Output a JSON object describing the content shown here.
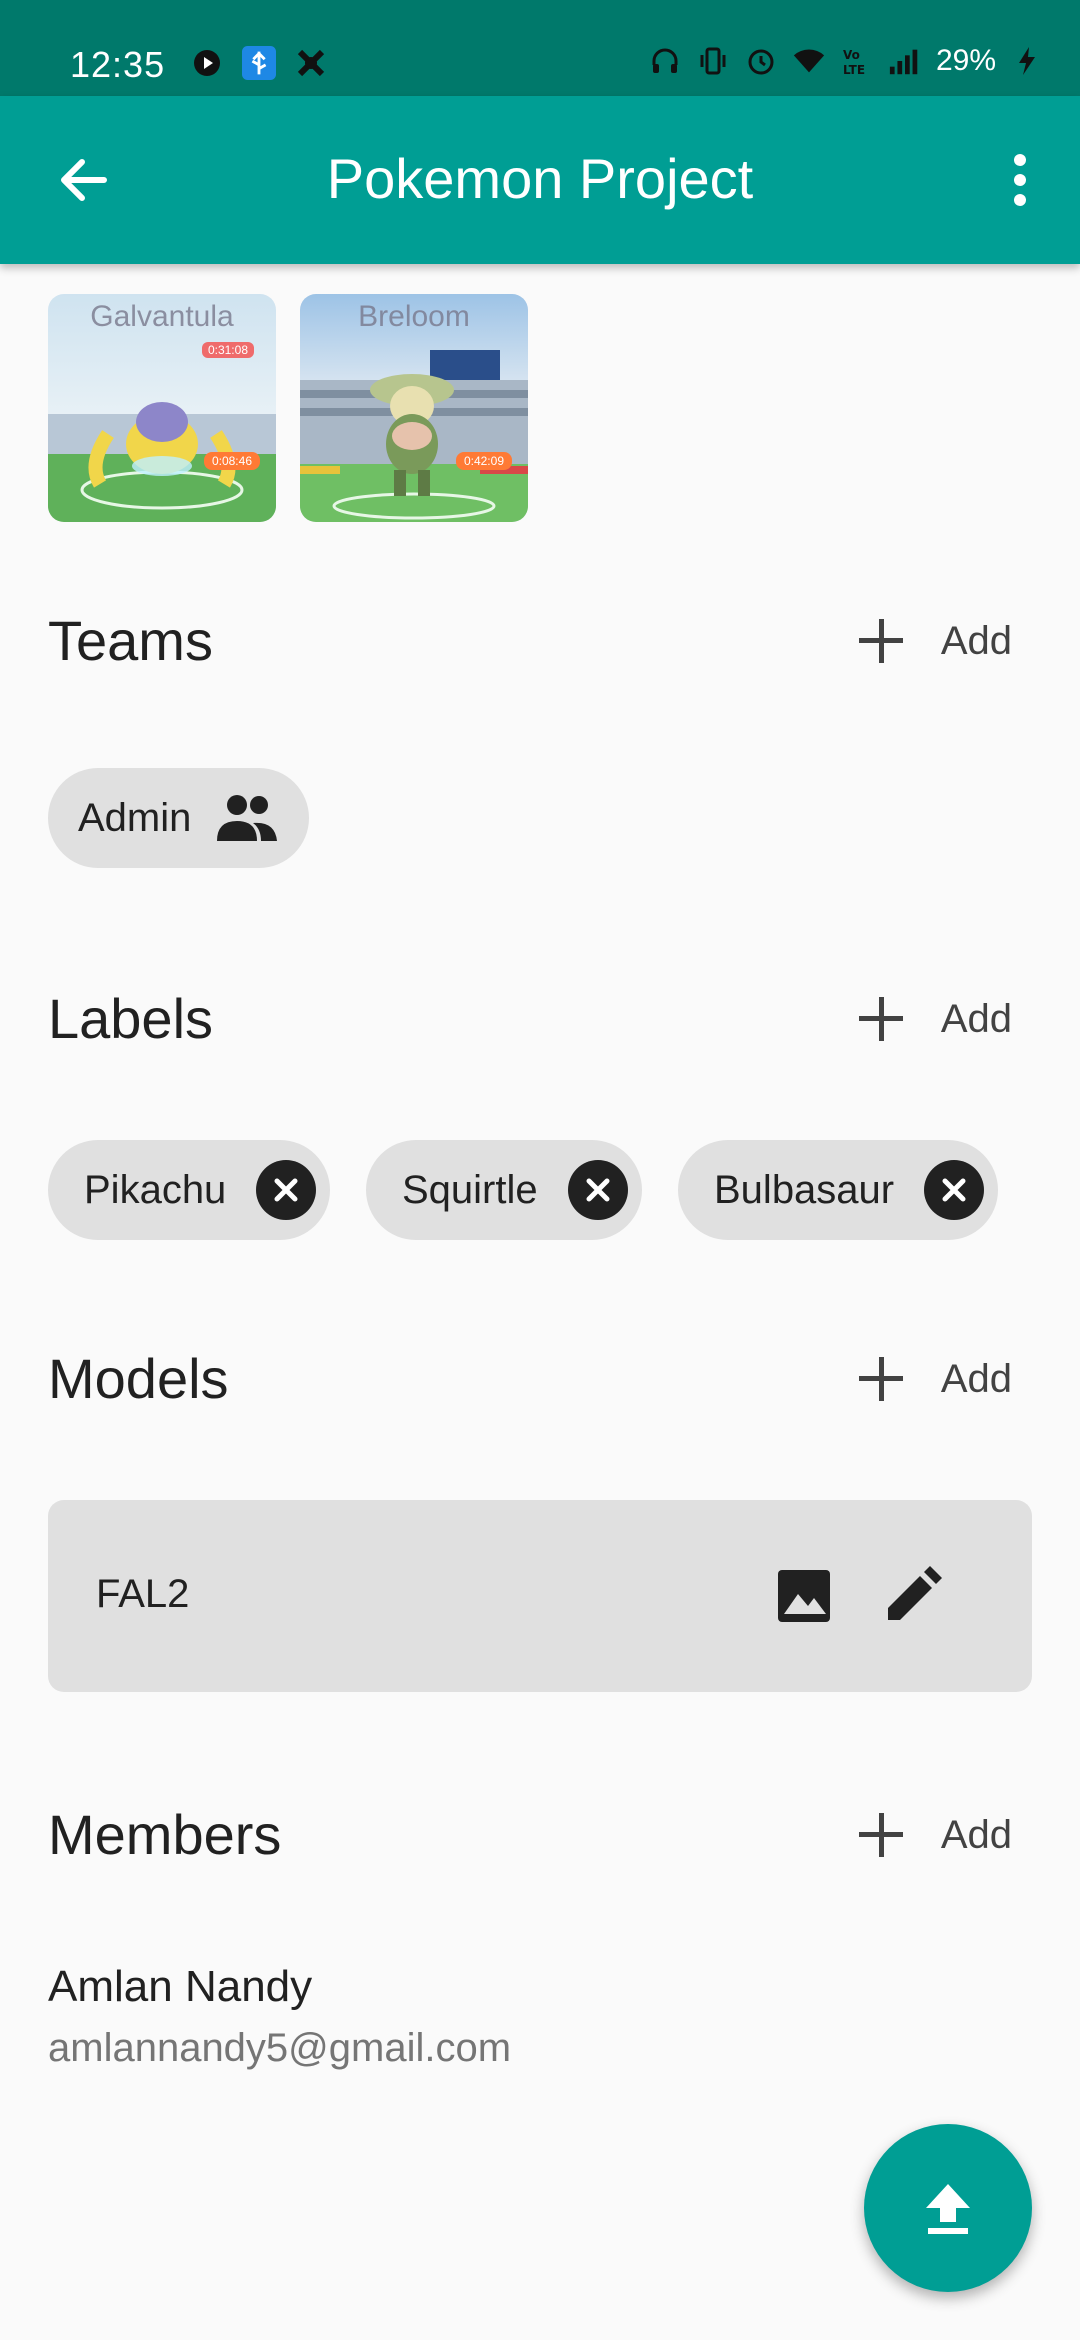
{
  "status_bar": {
    "time": "12:35",
    "battery": "29%",
    "left_icons": [
      "media-icon",
      "usb-icon",
      "app-icon"
    ],
    "right_icons": [
      "headphones-icon",
      "vibrate-icon",
      "alarm-icon",
      "wifi-icon",
      "volte-icon",
      "signal-icon",
      "charging-icon"
    ]
  },
  "app_bar": {
    "title": "Pokemon Project",
    "background": "#009e94"
  },
  "images": [
    {
      "caption": "Galvantula",
      "timer": "0:31:08",
      "badge": "0:08:46"
    },
    {
      "caption": "Breloom",
      "badge": "0:42:09"
    }
  ],
  "sections": {
    "teams": {
      "title": "Teams",
      "add_label": "Add",
      "chips": [
        {
          "label": "Admin",
          "icon": "group-icon"
        }
      ]
    },
    "labels": {
      "title": "Labels",
      "add_label": "Add",
      "chips": [
        {
          "label": "Pikachu"
        },
        {
          "label": "Squirtle"
        },
        {
          "label": "Bulbasaur"
        }
      ]
    },
    "models": {
      "title": "Models",
      "add_label": "Add",
      "items": [
        {
          "name": "FAL2"
        }
      ]
    },
    "members": {
      "title": "Members",
      "add_label": "Add",
      "items": [
        {
          "name": "Amlan Nandy",
          "email": "amlannandy5@gmail.com"
        }
      ]
    }
  },
  "fab": {
    "icon": "upload-icon"
  }
}
